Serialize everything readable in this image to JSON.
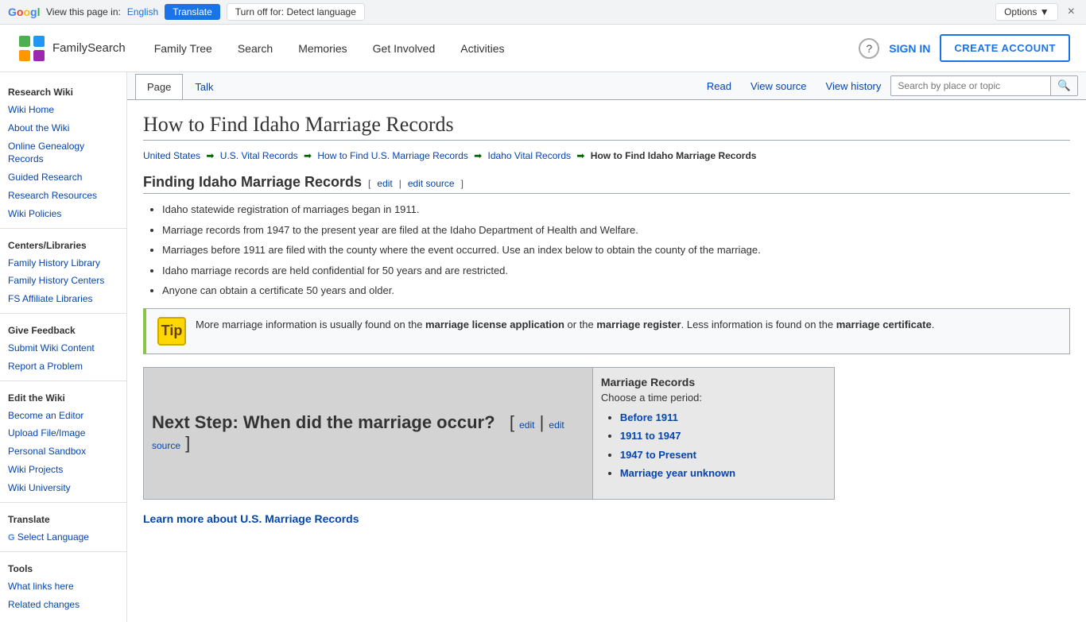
{
  "translate_bar": {
    "label": "View this page in:",
    "language": "English",
    "translate_btn": "Translate",
    "turn_off_btn": "Turn off for: Detect language",
    "options_btn": "Options ▼",
    "close_btn": "×"
  },
  "header": {
    "logo_text": "FamilySearch",
    "nav": [
      {
        "label": "Family Tree",
        "href": "#"
      },
      {
        "label": "Search",
        "href": "#"
      },
      {
        "label": "Memories",
        "href": "#"
      },
      {
        "label": "Get Involved",
        "href": "#"
      },
      {
        "label": "Activities",
        "href": "#"
      }
    ],
    "help_icon": "?",
    "sign_in": "SIGN IN",
    "create_account": "CREATE ACCOUNT"
  },
  "sidebar": {
    "sections": [
      {
        "title": "Research Wiki",
        "links": [
          {
            "label": "Wiki Home",
            "href": "#"
          },
          {
            "label": "About the Wiki",
            "href": "#"
          },
          {
            "label": "Online Genealogy Records",
            "href": "#"
          },
          {
            "label": "Guided Research",
            "href": "#"
          },
          {
            "label": "Research Resources",
            "href": "#"
          },
          {
            "label": "Wiki Policies",
            "href": "#"
          }
        ]
      },
      {
        "title": "Centers/Libraries",
        "links": [
          {
            "label": "Family History Library",
            "href": "#"
          },
          {
            "label": "Family History Centers",
            "href": "#"
          },
          {
            "label": "FS Affiliate Libraries",
            "href": "#"
          }
        ]
      },
      {
        "title": "Give Feedback",
        "links": [
          {
            "label": "Submit Wiki Content",
            "href": "#"
          },
          {
            "label": "Report a Problem",
            "href": "#"
          }
        ]
      },
      {
        "title": "Edit the Wiki",
        "links": [
          {
            "label": "Become an Editor",
            "href": "#"
          },
          {
            "label": "Upload File/Image",
            "href": "#"
          },
          {
            "label": "Personal Sandbox",
            "href": "#"
          },
          {
            "label": "Wiki Projects",
            "href": "#"
          },
          {
            "label": "Wiki University",
            "href": "#"
          }
        ]
      },
      {
        "title": "Translate",
        "links": [
          {
            "label": "Select Language",
            "href": "#"
          }
        ]
      },
      {
        "title": "Tools",
        "links": [
          {
            "label": "What links here",
            "href": "#"
          },
          {
            "label": "Related changes",
            "href": "#"
          }
        ]
      }
    ]
  },
  "wiki_tabs": {
    "page_tab": "Page",
    "talk_tab": "Talk",
    "read_tab": "Read",
    "view_source_tab": "View source",
    "view_history_tab": "View history",
    "search_placeholder": "Search by place or topic"
  },
  "article": {
    "title": "How to Find Idaho Marriage Records",
    "breadcrumb": [
      {
        "label": "United States",
        "href": "#"
      },
      {
        "label": "U.S. Vital Records",
        "href": "#"
      },
      {
        "label": "How to Find U.S. Marriage Records",
        "href": "#"
      },
      {
        "label": "Idaho Vital Records",
        "href": "#"
      },
      {
        "label": "How to Find Idaho Marriage Records",
        "current": true
      }
    ],
    "section_heading": "Finding Idaho Marriage Records",
    "edit_link": "edit",
    "edit_source_link": "edit source",
    "bullets": [
      "Idaho statewide registration of marriages began in 1911.",
      "Marriage records from 1947 to the present year are filed at the Idaho Department of Health and Welfare.",
      "Marriages before 1911 are filed with the county where the event occurred. Use an index below to obtain the county of the marriage.",
      "Idaho marriage records are held confidential for 50 years and are restricted.",
      "Anyone can obtain a certificate 50 years and older."
    ],
    "tip_text_before": "More marriage information is usually found on the ",
    "tip_bold1": "marriage license application",
    "tip_text_mid": " or the ",
    "tip_bold2": "marriage register",
    "tip_text_after": ". Less information is found on the ",
    "tip_bold3": "marriage certificate",
    "tip_text_end": ".",
    "next_step_label": "Next Step: When did the marriage occur?",
    "next_step_edit": "edit",
    "next_step_edit_source": "edit source",
    "marriage_records_title": "Marriage Records",
    "marriage_records_subtitle": "Choose a time period:",
    "marriage_records_links": [
      {
        "label": "Before 1911",
        "href": "#"
      },
      {
        "label": "1911 to 1947",
        "href": "#"
      },
      {
        "label": "1947 to Present",
        "href": "#"
      },
      {
        "label": "Marriage year unknown",
        "href": "#"
      }
    ],
    "learn_more_label": "Learn more about U.S. Marriage Records"
  }
}
